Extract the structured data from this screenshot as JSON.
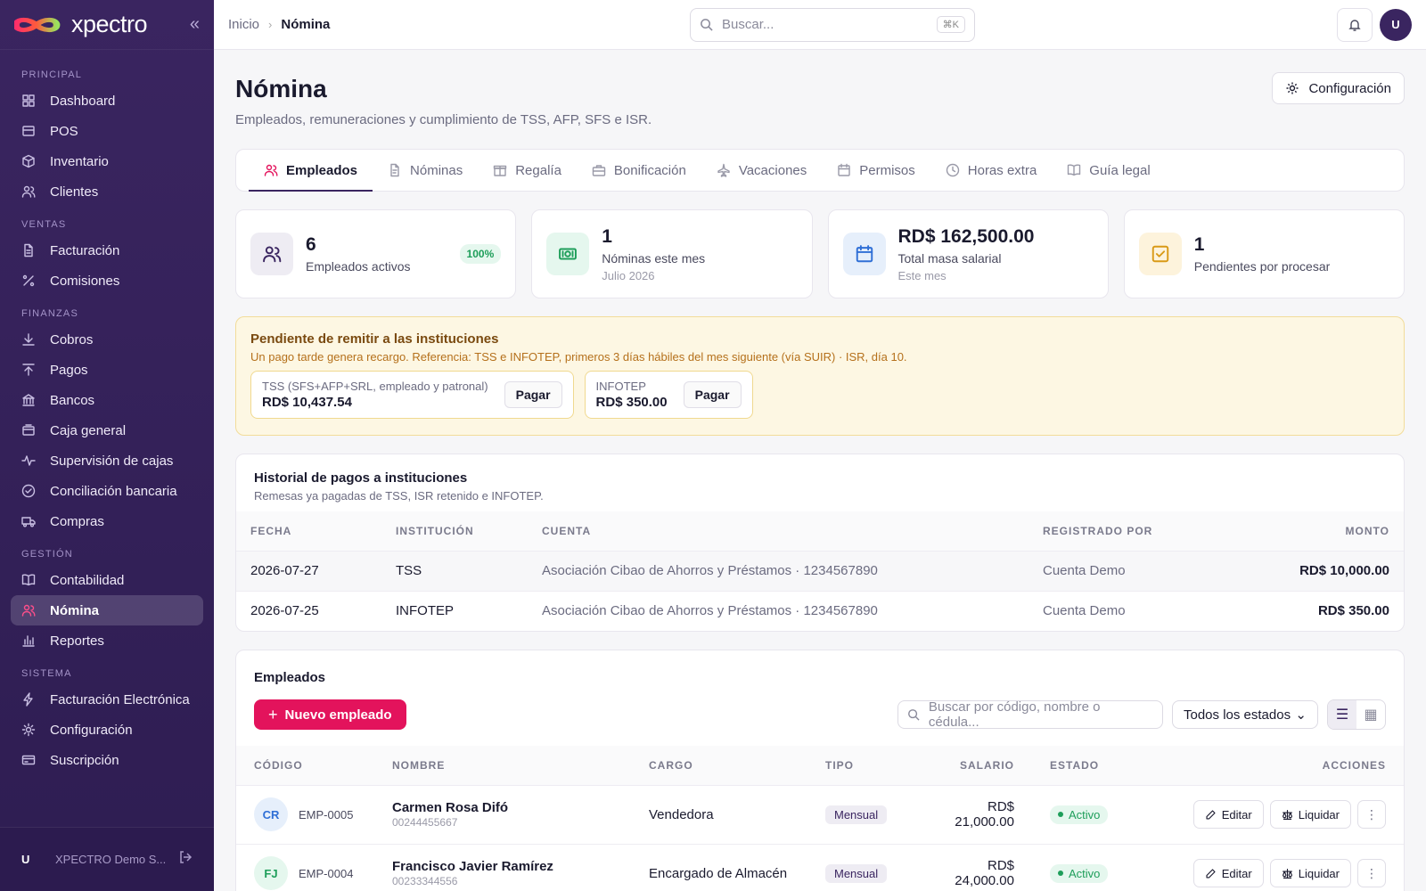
{
  "brand": {
    "name": "xpectro"
  },
  "sidebar": {
    "sections": [
      {
        "title": "PRINCIPAL",
        "items": [
          {
            "label": "Dashboard",
            "icon": "dashboard-icon"
          },
          {
            "label": "POS",
            "icon": "pos-icon"
          },
          {
            "label": "Inventario",
            "icon": "box-icon"
          },
          {
            "label": "Clientes",
            "icon": "users-icon"
          }
        ]
      },
      {
        "title": "VENTAS",
        "items": [
          {
            "label": "Facturación",
            "icon": "file-icon"
          },
          {
            "label": "Comisiones",
            "icon": "percent-icon"
          }
        ]
      },
      {
        "title": "FINANZAS",
        "items": [
          {
            "label": "Cobros",
            "icon": "arrow-down-icon"
          },
          {
            "label": "Pagos",
            "icon": "arrow-up-icon"
          },
          {
            "label": "Bancos",
            "icon": "bank-icon"
          },
          {
            "label": "Caja general",
            "icon": "cash-box-icon"
          },
          {
            "label": "Supervisión de cajas",
            "icon": "activity-icon"
          },
          {
            "label": "Conciliación bancaria",
            "icon": "check-circle-icon"
          },
          {
            "label": "Compras",
            "icon": "truck-icon"
          }
        ]
      },
      {
        "title": "GESTIÓN",
        "items": [
          {
            "label": "Contabilidad",
            "icon": "book-icon"
          },
          {
            "label": "Nómina",
            "icon": "users-icon",
            "active": true
          },
          {
            "label": "Reportes",
            "icon": "bar-chart-icon"
          }
        ]
      },
      {
        "title": "SISTEMA",
        "items": [
          {
            "label": "Facturación Electrónica",
            "icon": "lightning-icon"
          },
          {
            "label": "Configuración",
            "icon": "gear-icon"
          },
          {
            "label": "Suscripción",
            "icon": "card-icon"
          }
        ]
      }
    ],
    "footer": {
      "initial": "U",
      "name": "XPECTRO Demo S..."
    }
  },
  "header": {
    "breadcrumb": {
      "home": "Inicio",
      "current": "Nómina"
    },
    "search_placeholder": "Buscar...",
    "search_shortcut": "⌘K",
    "avatar_initial": "U"
  },
  "page": {
    "title": "Nómina",
    "subtitle": "Empleados, remuneraciones y cumplimiento de TSS, AFP, SFS e ISR.",
    "config_button": "Configuración"
  },
  "tabs": [
    {
      "label": "Empleados",
      "active": true
    },
    {
      "label": "Nóminas"
    },
    {
      "label": "Regalía"
    },
    {
      "label": "Bonificación"
    },
    {
      "label": "Vacaciones"
    },
    {
      "label": "Permisos"
    },
    {
      "label": "Horas extra"
    },
    {
      "label": "Guía legal"
    }
  ],
  "stats": [
    {
      "value": "6",
      "label": "Empleados activos",
      "badge": "100%",
      "icon": "users-icon",
      "color": "#3a2560",
      "bg": "#eeecf3"
    },
    {
      "value": "1",
      "label": "Nóminas este mes",
      "sub": "Julio 2026",
      "icon": "money-icon",
      "color": "#1e9e5a",
      "bg": "#e5f7ee"
    },
    {
      "value": "RD$ 162,500.00",
      "label": "Total masa salarial",
      "sub": "Este mes",
      "icon": "calendar-icon",
      "color": "#2f6fd6",
      "bg": "#e6effb"
    },
    {
      "value": "1",
      "label": "Pendientes por procesar",
      "icon": "checkbox-icon",
      "color": "#d99a17",
      "bg": "#fdf3dc"
    }
  ],
  "alert": {
    "title": "Pendiente de remitir a las instituciones",
    "text": "Un pago tarde genera recargo. Referencia: TSS e INFOTEP, primeros 3 días hábiles del mes siguiente (vía SUIR) · ISR, día 10.",
    "items": [
      {
        "label": "TSS (SFS+AFP+SRL, empleado y patronal)",
        "amount": "RD$ 10,437.54",
        "button": "Pagar"
      },
      {
        "label": "INFOTEP",
        "amount": "RD$ 350.00",
        "button": "Pagar"
      }
    ]
  },
  "history": {
    "title": "Historial de pagos a instituciones",
    "subtitle": "Remesas ya pagadas de TSS, ISR retenido e INFOTEP.",
    "columns": [
      "FECHA",
      "INSTITUCIÓN",
      "CUENTA",
      "REGISTRADO POR",
      "MONTO"
    ],
    "rows": [
      {
        "date": "2026-07-27",
        "institution": "TSS",
        "account": "Asociación Cibao de Ahorros y Préstamos · 1234567890",
        "by": "Cuenta Demo",
        "amount": "RD$ 10,000.00"
      },
      {
        "date": "2026-07-25",
        "institution": "INFOTEP",
        "account": "Asociación Cibao de Ahorros y Préstamos · 1234567890",
        "by": "Cuenta Demo",
        "amount": "RD$ 350.00"
      }
    ]
  },
  "employees": {
    "title": "Empleados",
    "new_button": "Nuevo empleado",
    "search_placeholder": "Buscar por código, nombre o cédula...",
    "status_filter": "Todos los estados",
    "columns": [
      "CÓDIGO",
      "NOMBRE",
      "CARGO",
      "TIPO",
      "SALARIO",
      "ESTADO",
      "ACCIONES"
    ],
    "edit_label": "Editar",
    "settle_label": "Liquidar",
    "rows": [
      {
        "initials": "CR",
        "code": "EMP-0005",
        "name": "Carmen Rosa Difó",
        "id": "00244455667",
        "position": "Vendedora",
        "type": "Mensual",
        "salary": "RD$ 21,000.00",
        "status": "Activo",
        "color": "#2f6fd6",
        "bg": "#e6effb"
      },
      {
        "initials": "FJ",
        "code": "EMP-0004",
        "name": "Francisco Javier Ramírez",
        "id": "00233344556",
        "position": "Encargado de Almacén",
        "type": "Mensual",
        "salary": "RD$ 24,000.00",
        "status": "Activo",
        "color": "#1e9e5a",
        "bg": "#e5f7ee"
      }
    ]
  }
}
